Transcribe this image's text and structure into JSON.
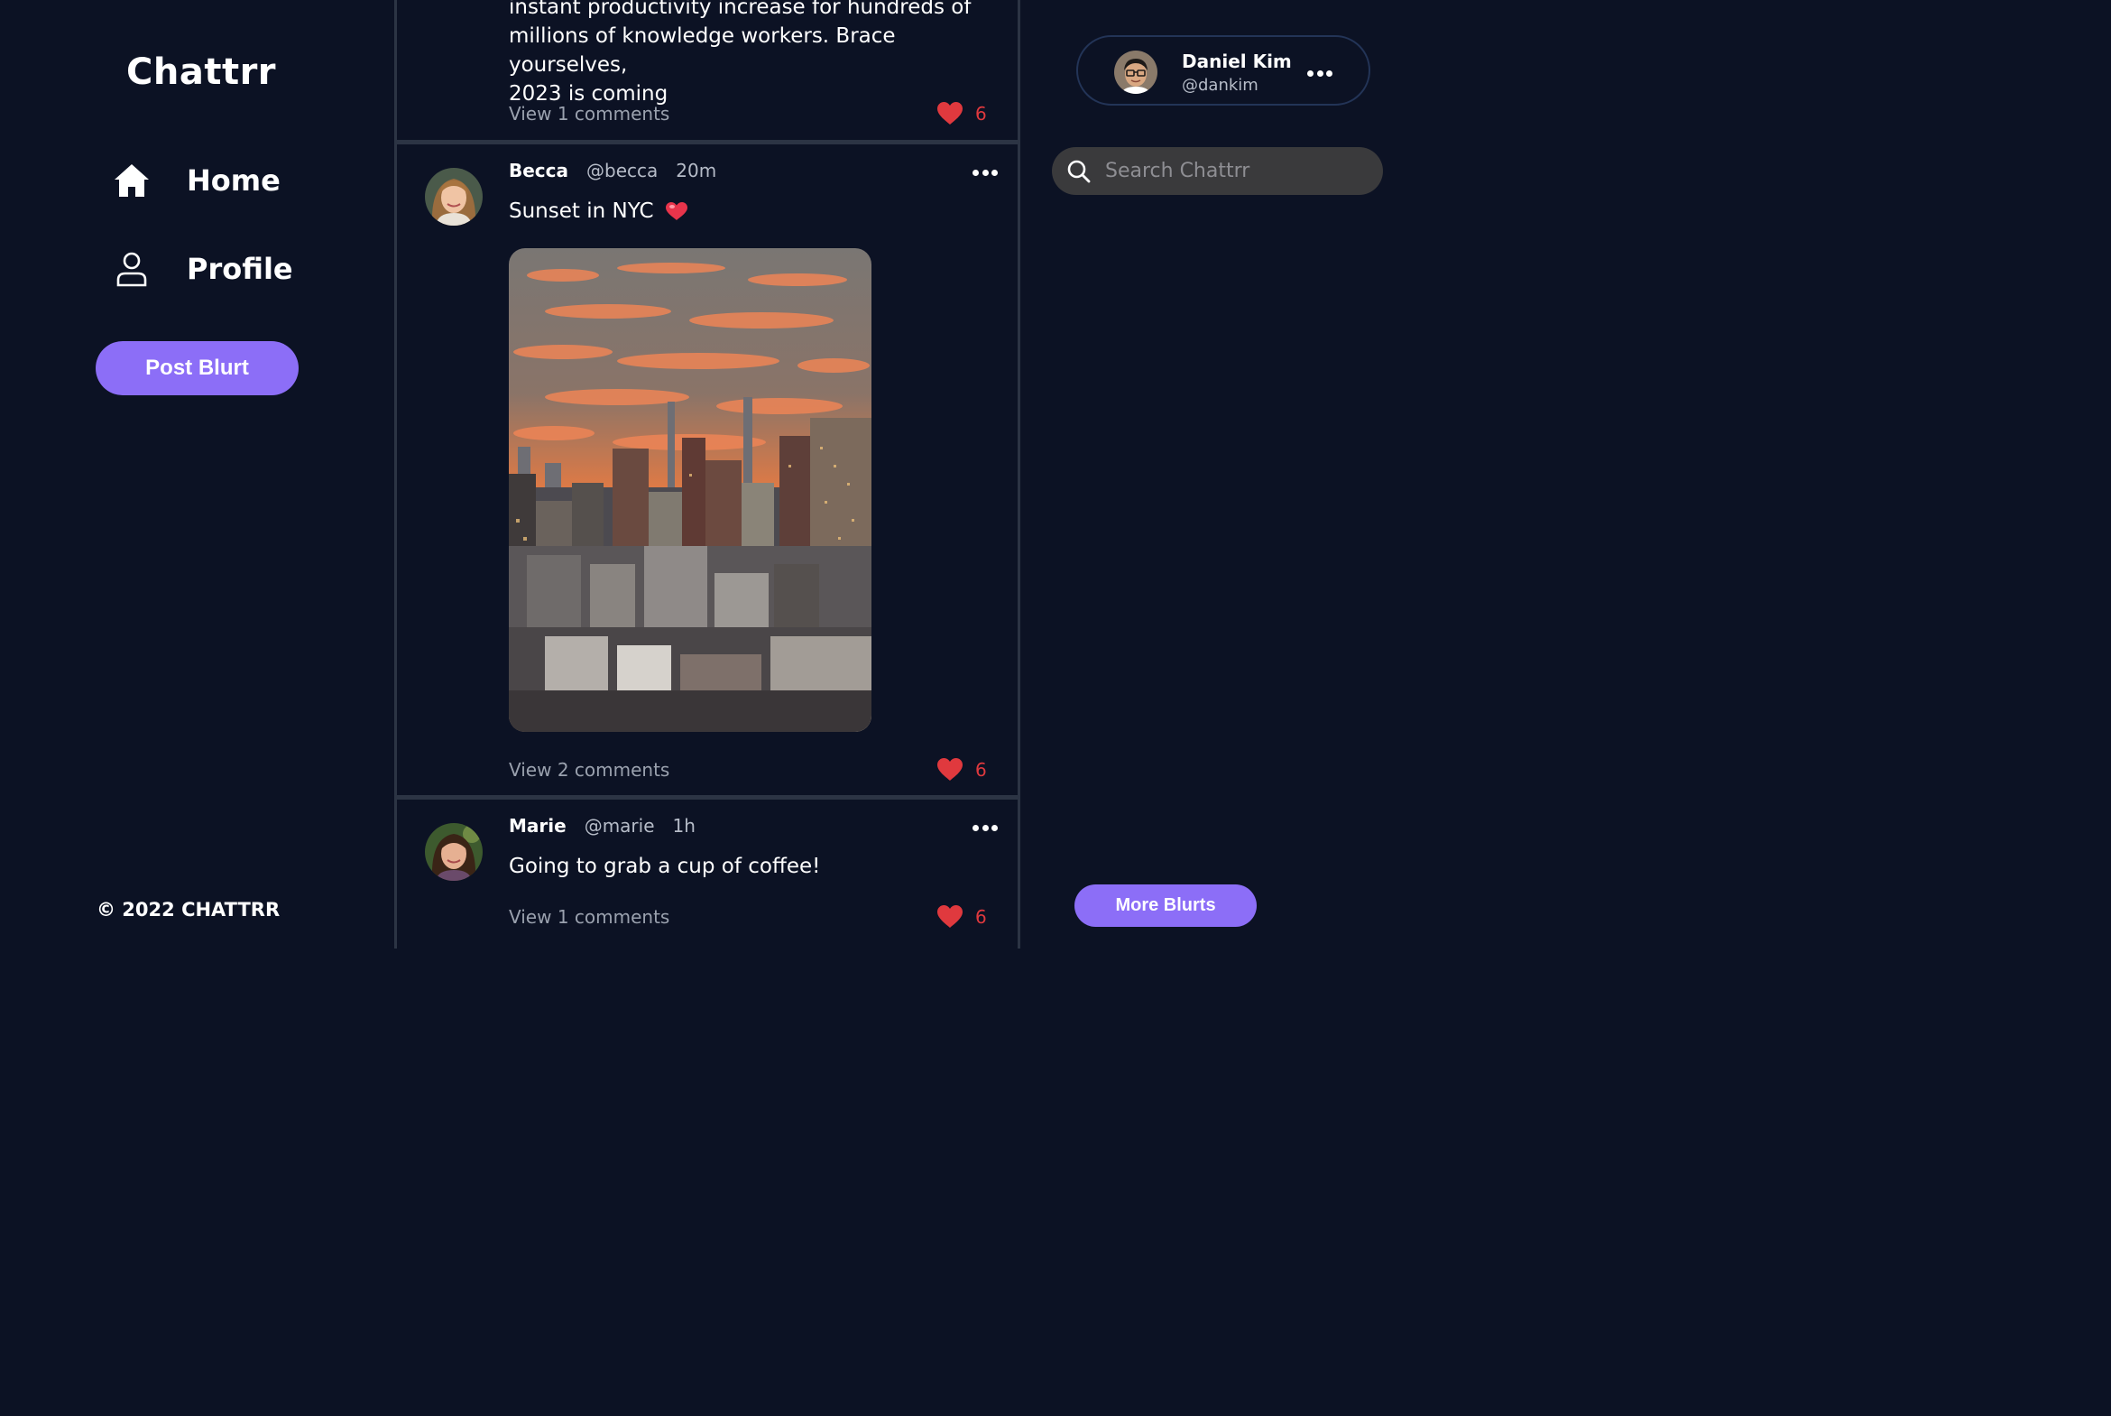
{
  "app": {
    "name": "Chattrr"
  },
  "sidebar": {
    "nav": [
      {
        "label": "Home",
        "icon": "home-icon"
      },
      {
        "label": "Profile",
        "icon": "user-icon"
      }
    ],
    "post_button": "Post Blurt",
    "copyright": "© 2022 CHATTRR"
  },
  "feed": {
    "posts": [
      {
        "text_lines": [
          "instant productivity increase for hundreds of",
          "millions of knowledge workers. Brace yourselves,",
          "2023 is coming"
        ],
        "comments": "View 1 comments",
        "likes": "6"
      },
      {
        "author": "Becca",
        "handle": "@becca",
        "time": "20m",
        "text": "Sunset in NYC",
        "emoji": "heart-emoji",
        "image": "nyc-sunset-photo",
        "comments": "View 2 comments",
        "likes": "6"
      },
      {
        "author": "Marie",
        "handle": "@marie",
        "time": "1h",
        "text": "Going to grab a cup of coffee!",
        "comments": "View 1 comments",
        "likes": "6"
      }
    ]
  },
  "account": {
    "name": "Daniel Kim",
    "handle": "@dankim"
  },
  "search": {
    "placeholder": "Search Chattrr"
  },
  "more_button": "More Blurts",
  "colors": {
    "background": "#0c1224",
    "accent": "#8c6ef7",
    "like": "#e0393e",
    "divider": "#2c3444"
  }
}
